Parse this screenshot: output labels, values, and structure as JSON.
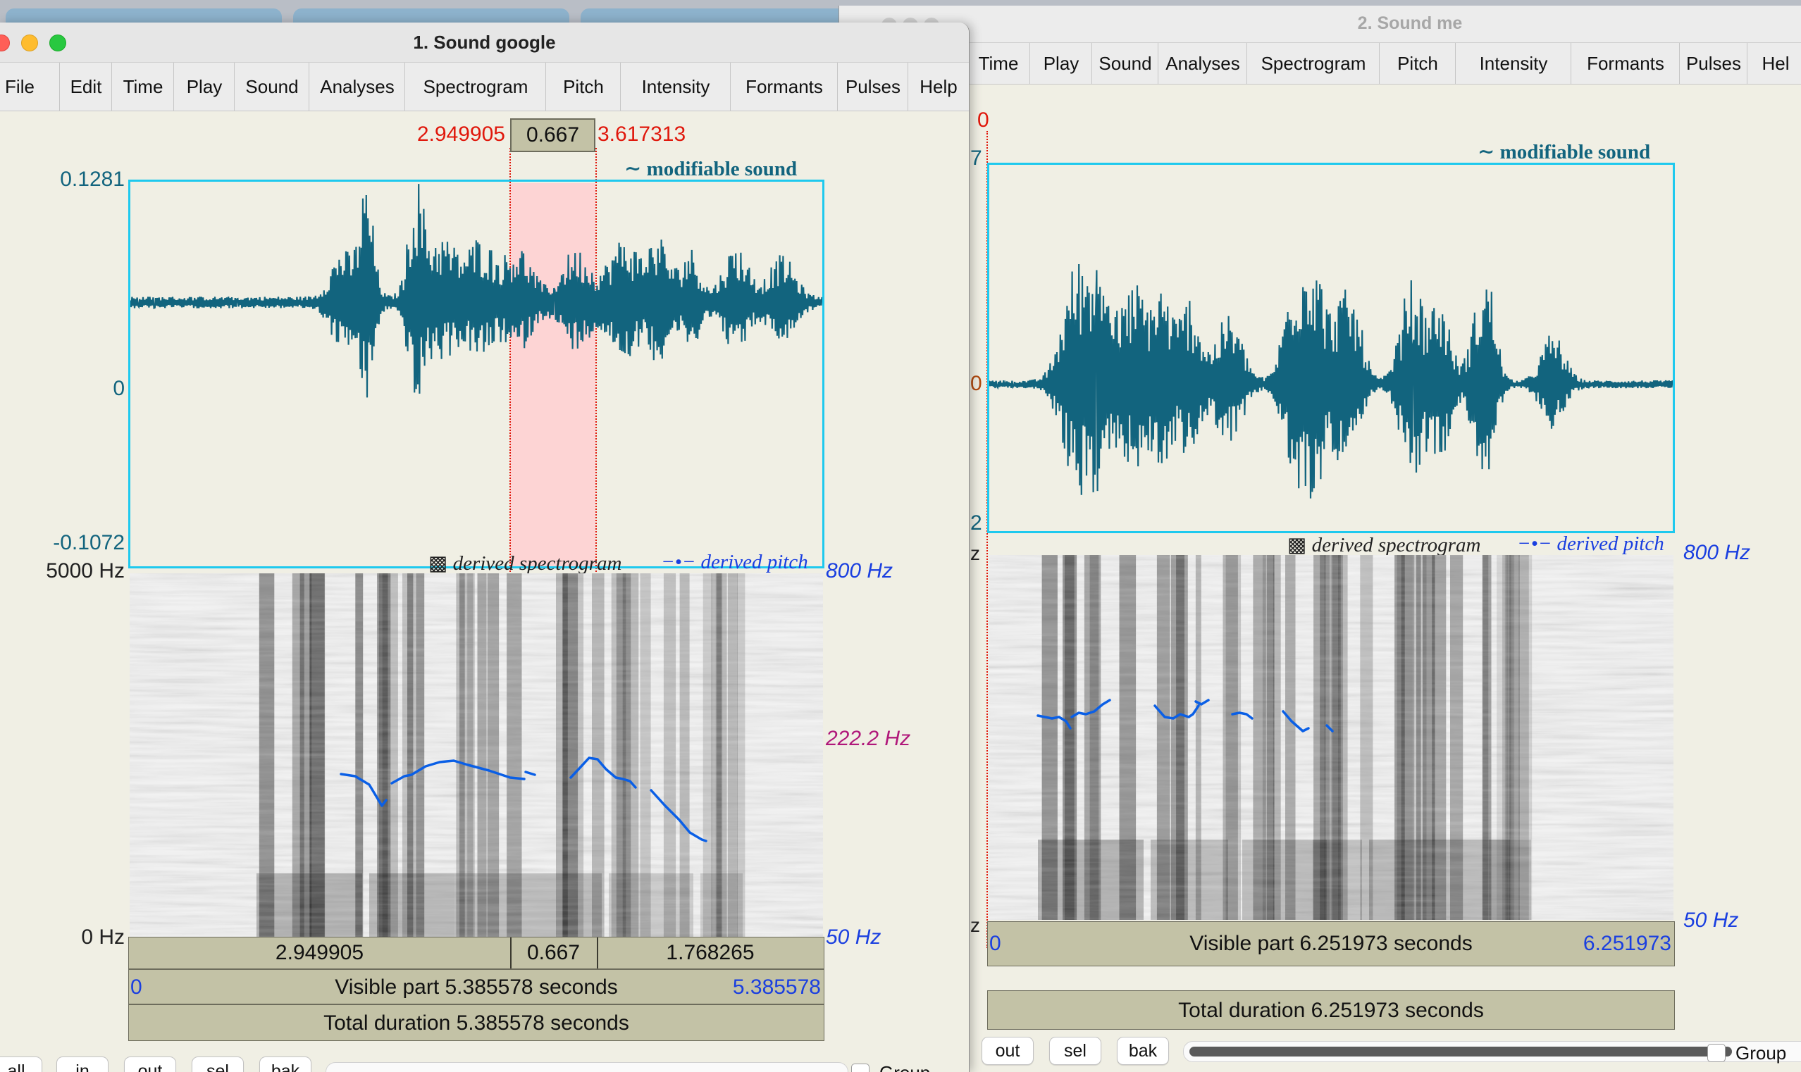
{
  "colors": {
    "wave": "#12647e",
    "frame": "#1ec9ee",
    "selection": "#fdd4d4",
    "cursor_red": "#e0180c",
    "pitch_blue": "#1a3fe0",
    "pitch_curve": "#0a5fe6",
    "freq_magenta": "#b0187a",
    "axis_teal": "#12647e"
  },
  "win1": {
    "title": "1. Sound google",
    "menu": [
      "File",
      "Edit",
      "Time",
      "Play",
      "Sound",
      "Analyses",
      "Spectrogram",
      "Pitch",
      "Intensity",
      "Formants",
      "Pulses",
      "Help"
    ],
    "sel_start": "2.949905",
    "sel_dur": "0.667",
    "sel_end": "3.617313",
    "legend_sound": "modifiable sound",
    "y_max": "0.1281",
    "y_zero": "0",
    "y_min": "-0.1072",
    "freq_top": "5000 Hz",
    "freq_bottom": "0 Hz",
    "legend_spectro": "derived spectrogram",
    "legend_pitch": "derived pitch",
    "pitch_top": "800 Hz",
    "pitch_mid": "222.2 Hz",
    "pitch_bottom": "50 Hz",
    "bar_left": "2.949905",
    "bar_mid": "0.667",
    "bar_right": "1.768265",
    "vis_start": "0",
    "visible": "Visible part 5.385578 seconds",
    "vis_end": "5.385578",
    "total": "Total duration 5.385578 seconds",
    "buttons": [
      "all",
      "in",
      "out",
      "sel",
      "bak"
    ],
    "group_label": "Group"
  },
  "win2": {
    "title": "2. Sound me",
    "menu": [
      "Time",
      "Play",
      "Sound",
      "Analyses",
      "Spectrogram",
      "Pitch",
      "Intensity",
      "Formants",
      "Pulses",
      "Hel"
    ],
    "cursor": "0",
    "legend_sound": "modifiable sound",
    "y_top_frag": "7",
    "y_zero": "0",
    "y_bottom_frag": "2",
    "freq_top_frag": "z",
    "freq_bottom_frag": "z",
    "legend_spectro": "derived spectrogram",
    "legend_pitch": "derived pitch",
    "pitch_top": "800 Hz",
    "pitch_bottom": "50 Hz",
    "vis_start": "0",
    "visible": "Visible part 6.251973 seconds",
    "vis_end": "6.251973",
    "total": "Total duration 6.251973 seconds",
    "buttons": [
      "out",
      "sel",
      "bak"
    ],
    "group_label": "Group"
  }
}
